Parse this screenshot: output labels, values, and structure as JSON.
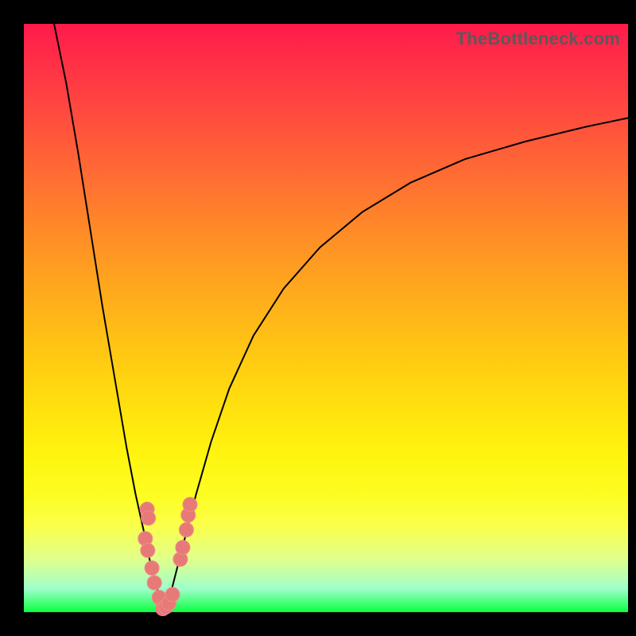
{
  "watermark": "TheBottleneck.com",
  "colors": {
    "curve_stroke": "#000000",
    "marker_fill": "#e77a77",
    "marker_stroke": "#ef8b88",
    "background": "#000000"
  },
  "chart_data": {
    "type": "line",
    "title": "",
    "xlabel": "",
    "ylabel": "",
    "xlim": [
      0,
      100
    ],
    "ylim": [
      0,
      100
    ],
    "grid": false,
    "legend": false,
    "series": [
      {
        "name": "bottleneck-curve-left",
        "x": [
          5,
          7,
          9,
          11,
          13,
          15,
          17,
          18.5,
          19.8,
          20.8,
          21.5,
          22.2,
          22.8,
          23.3
        ],
        "values": [
          100,
          90,
          78,
          65,
          52,
          40,
          28,
          20,
          14,
          9,
          6,
          3.5,
          1.5,
          0.2
        ]
      },
      {
        "name": "bottleneck-curve-right",
        "x": [
          23.3,
          24,
          25,
          26.5,
          28.5,
          31,
          34,
          38,
          43,
          49,
          56,
          64,
          73,
          83,
          93,
          100
        ],
        "values": [
          0.2,
          2,
          6,
          12,
          20,
          29,
          38,
          47,
          55,
          62,
          68,
          73,
          77,
          80,
          82.5,
          84
        ]
      }
    ],
    "markers": [
      {
        "x": 20.4,
        "y": 17.5
      },
      {
        "x": 20.6,
        "y": 16.0
      },
      {
        "x": 20.1,
        "y": 12.5
      },
      {
        "x": 20.5,
        "y": 10.5
      },
      {
        "x": 21.2,
        "y": 7.5
      },
      {
        "x": 21.6,
        "y": 5.0
      },
      {
        "x": 22.4,
        "y": 2.5
      },
      {
        "x": 23.0,
        "y": 0.6
      },
      {
        "x": 23.5,
        "y": 0.9
      },
      {
        "x": 24.0,
        "y": 1.5
      },
      {
        "x": 24.6,
        "y": 3.0
      },
      {
        "x": 25.9,
        "y": 9.0
      },
      {
        "x": 26.3,
        "y": 11.0
      },
      {
        "x": 26.9,
        "y": 14.0
      },
      {
        "x": 27.2,
        "y": 16.5
      },
      {
        "x": 27.5,
        "y": 18.3
      }
    ],
    "gradient_stops": [
      {
        "pos": 0.0,
        "color": "#ff1a4b"
      },
      {
        "pos": 0.15,
        "color": "#ff4a3f"
      },
      {
        "pos": 0.35,
        "color": "#ff8a28"
      },
      {
        "pos": 0.55,
        "color": "#ffc514"
      },
      {
        "pos": 0.73,
        "color": "#fff40f"
      },
      {
        "pos": 0.85,
        "color": "#fbff47"
      },
      {
        "pos": 0.96,
        "color": "#9fffcb"
      },
      {
        "pos": 1.0,
        "color": "#0aff41"
      }
    ]
  }
}
